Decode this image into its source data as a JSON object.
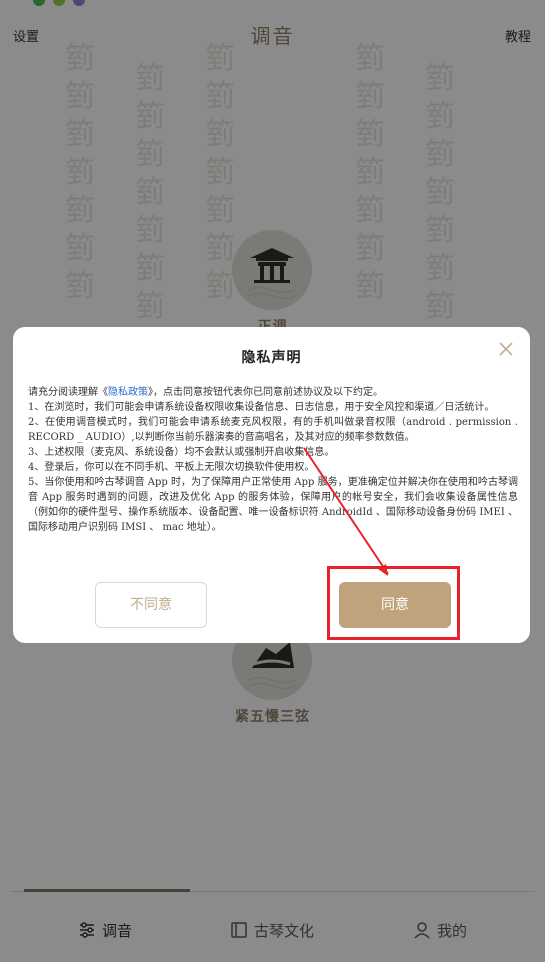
{
  "header": {
    "left_label": "设置",
    "title": "调音",
    "right_label": "教程"
  },
  "background_glyph": "箌",
  "tunings": [
    {
      "label": "正调"
    },
    {
      "label": "紧五慢三弦"
    }
  ],
  "dialog": {
    "title": "隐私声明",
    "intro_prefix": "请充分阅读理解《",
    "policy_link": "隐私政策",
    "intro_suffix": "》，点击同意按钮代表你已同意前述协议及以下约定。",
    "items": [
      "1、在浏览时，我们可能会申请系统设备权限收集设备信息、日志信息，用于安全风控和渠道／日活统计。",
      "2、在使用调音模式时，我们可能会申请系统麦克风权限，有的手机叫做录音权限（android . permission . RECORD _ AUDIO）,以判断你当前乐器演奏的音高唱名，及其对应的频率参数数值。",
      "3、上述权限（麦克风、系统设备）均不会默认或强制开启收集信息。",
      "4、登录后，你可以在不同手机、平板上无限次切换软件使用权。",
      "5、当你使用和吟古琴调音 App 时，为了保障用户正常使用 App 服务，更准确定位并解决你在使用和吟古琴调音 App 服务时遇到的问题，改进及优化 App 的服务体验，保障用户的帐号安全，我们会收集设备属性信息（例如你的硬件型号、操作系统版本、设备配置、唯一设备标识符 AndroidId 、国际移动设备身份码 IMEI 、国际移动用户识别码 IMSI 、 mac 地址）。"
    ],
    "disagree_label": "不同意",
    "agree_label": "同意"
  },
  "tabs": [
    {
      "label": "调音",
      "icon": "sliders-icon",
      "active": true
    },
    {
      "label": "古琴文化",
      "icon": "book-icon",
      "active": false
    },
    {
      "label": "我的",
      "icon": "person-icon",
      "active": false
    }
  ],
  "colors": {
    "accent": "#c0a27c",
    "title_brown": "#8b7a62",
    "annotation_red": "#e7222a",
    "link_blue": "#2b6fd1"
  }
}
